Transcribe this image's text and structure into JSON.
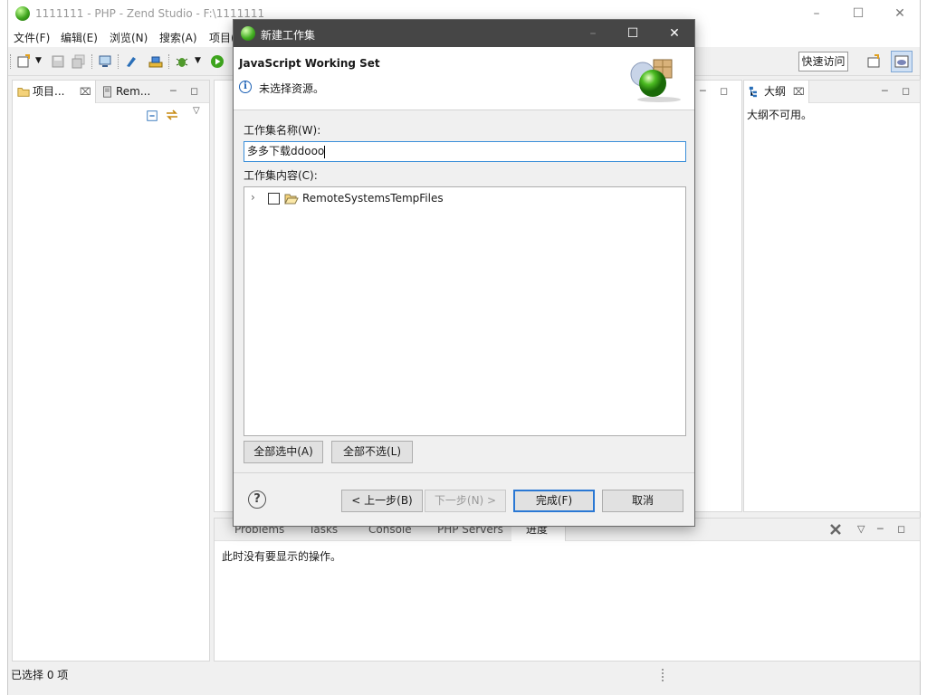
{
  "window": {
    "title": "1111111  -  PHP  -  Zend Studio  -  F:\\1111111"
  },
  "menu": [
    "文件(F)",
    "编辑(E)",
    "浏览(N)",
    "搜索(A)",
    "项目("
  ],
  "toolbar": {
    "quick_access": "快速访问"
  },
  "left_panel": {
    "tab1": "项目...",
    "tab2": "Rem..."
  },
  "outline_panel": {
    "tab": "大纲",
    "message": "大纲不可用。"
  },
  "bottom_panel": {
    "tabs": [
      "Problems",
      "Tasks",
      "Console",
      "PHP Servers",
      "进度"
    ],
    "message": "此时没有要显示的操作。"
  },
  "status": {
    "text": "已选择 0 项"
  },
  "dialog": {
    "title": "新建工作集",
    "heading": "JavaScript Working Set",
    "message": "未选择资源。",
    "name_label": "工作集名称(W):",
    "name_value": "多多下载ddooo",
    "content_label": "工作集内容(C):",
    "tree_item": "RemoteSystemsTempFiles",
    "select_all": "全部选中(A)",
    "deselect_all": "全部不选(L)",
    "back": "< 上一步(B)",
    "next": "下一步(N) >",
    "finish": "完成(F)",
    "cancel": "取消"
  }
}
